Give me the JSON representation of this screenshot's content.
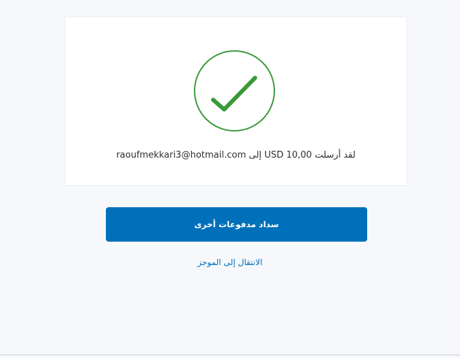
{
  "confirmation": {
    "message": "لقد أرسلت USD 10,00 إلى raoufmekkari3@hotmail.com",
    "amount": "USD 10,00",
    "recipient": "raoufmekkari3@hotmail.com",
    "status_icon": "checkmark-circle-icon",
    "status_color": "#3a9a3a"
  },
  "actions": {
    "send_another_label": "سداد مدفوعات أخرى",
    "go_to_summary_label": "الانتقال إلى الموجز"
  },
  "colors": {
    "primary": "#0070ba",
    "background": "#f6f8fb",
    "card": "#ffffff",
    "text": "#2c2e2f"
  }
}
